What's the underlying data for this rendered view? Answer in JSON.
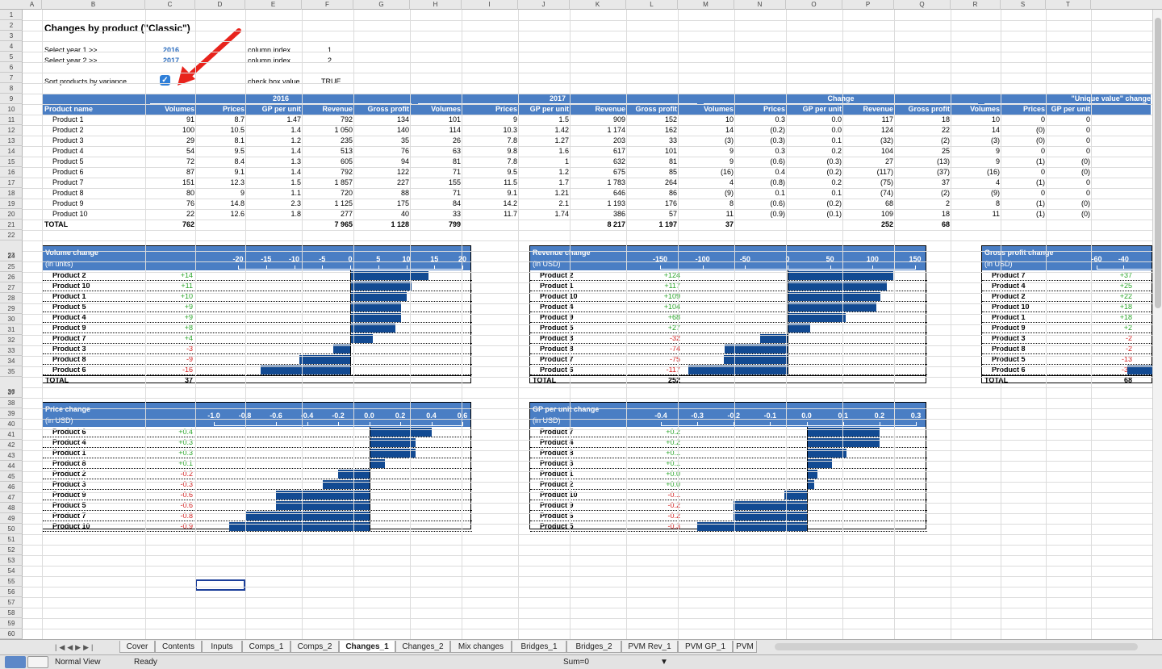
{
  "sheet_title": "Changes by product (\"Classic\")",
  "inputs": {
    "year1_label": "Select year 1 >>",
    "year1_value": "2016",
    "year2_label": "Select year 2 >>",
    "year2_value": "2017",
    "colidx_label": "column index",
    "colidx1": "1",
    "colidx2": "2",
    "sort_label": "Sort products by variance",
    "cbv_label": "check box value",
    "cbv_value": "TRUE"
  },
  "columns": [
    "A",
    "B",
    "C",
    "D",
    "E",
    "F",
    "G",
    "H",
    "I",
    "J",
    "K",
    "L",
    "M",
    "N",
    "O",
    "P",
    "Q",
    "R",
    "S",
    "T"
  ],
  "table": {
    "groups": [
      "2016",
      "2017",
      "Change",
      "\"Unique value\" change"
    ],
    "name_header": "Product name",
    "headers": [
      "Volumes",
      "Prices",
      "GP per unit",
      "Revenue",
      "Gross profit",
      "Volumes",
      "Prices",
      "GP per unit",
      "Revenue",
      "Gross profit",
      "Volumes",
      "Prices",
      "GP per unit",
      "Revenue",
      "Gross profit",
      "Volumes",
      "Prices",
      "GP per unit"
    ],
    "rows": [
      [
        "Product 1",
        "91",
        "8.7",
        "1.47",
        "792",
        "134",
        "101",
        "9",
        "1.5",
        "909",
        "152",
        "10",
        "0.3",
        "0.0",
        "117",
        "18",
        "10",
        "0",
        "0"
      ],
      [
        "Product 2",
        "100",
        "10.5",
        "1.4",
        "1 050",
        "140",
        "114",
        "10.3",
        "1.42",
        "1 174",
        "162",
        "14",
        "(0.2)",
        "0.0",
        "124",
        "22",
        "14",
        "(0)",
        "0"
      ],
      [
        "Product 3",
        "29",
        "8.1",
        "1.2",
        "235",
        "35",
        "26",
        "7.8",
        "1.27",
        "203",
        "33",
        "(3)",
        "(0.3)",
        "0.1",
        "(32)",
        "(2)",
        "(3)",
        "(0)",
        "0"
      ],
      [
        "Product 4",
        "54",
        "9.5",
        "1.4",
        "513",
        "76",
        "63",
        "9.8",
        "1.6",
        "617",
        "101",
        "9",
        "0.3",
        "0.2",
        "104",
        "25",
        "9",
        "0",
        "0"
      ],
      [
        "Product 5",
        "72",
        "8.4",
        "1.3",
        "605",
        "94",
        "81",
        "7.8",
        "1",
        "632",
        "81",
        "9",
        "(0.6)",
        "(0.3)",
        "27",
        "(13)",
        "9",
        "(1)",
        "(0)"
      ],
      [
        "Product 6",
        "87",
        "9.1",
        "1.4",
        "792",
        "122",
        "71",
        "9.5",
        "1.2",
        "675",
        "85",
        "(16)",
        "0.4",
        "(0.2)",
        "(117)",
        "(37)",
        "(16)",
        "0",
        "(0)"
      ],
      [
        "Product 7",
        "151",
        "12.3",
        "1.5",
        "1 857",
        "227",
        "155",
        "11.5",
        "1.7",
        "1 783",
        "264",
        "4",
        "(0.8)",
        "0.2",
        "(75)",
        "37",
        "4",
        "(1)",
        "0"
      ],
      [
        "Product 8",
        "80",
        "9",
        "1.1",
        "720",
        "88",
        "71",
        "9.1",
        "1.21",
        "646",
        "86",
        "(9)",
        "0.1",
        "0.1",
        "(74)",
        "(2)",
        "(9)",
        "0",
        "0"
      ],
      [
        "Product 9",
        "76",
        "14.8",
        "2.3",
        "1 125",
        "175",
        "84",
        "14.2",
        "2.1",
        "1 193",
        "176",
        "8",
        "(0.6)",
        "(0.2)",
        "68",
        "2",
        "8",
        "(1)",
        "(0)"
      ],
      [
        "Product 10",
        "22",
        "12.6",
        "1.8",
        "277",
        "40",
        "33",
        "11.7",
        "1.74",
        "386",
        "57",
        "11",
        "(0.9)",
        "(0.1)",
        "109",
        "18",
        "11",
        "(1)",
        "(0)"
      ]
    ],
    "total": [
      "TOTAL",
      "762",
      "",
      "",
      "7 965",
      "1 128",
      "799",
      "",
      "",
      "8 217",
      "1 197",
      "37",
      "",
      "",
      "252",
      "68",
      "",
      "",
      ""
    ]
  },
  "charts": [
    {
      "id": "volume",
      "title": "Volume change",
      "unit": "(in units)",
      "ticks": [
        "-20",
        "-15",
        "-10",
        "-5",
        "0",
        "5",
        "10",
        "15",
        "20"
      ],
      "min": -20,
      "max": 20,
      "products": [
        "Product 2",
        "Product 10",
        "Product 1",
        "Product 5",
        "Product 4",
        "Product 9",
        "Product 7",
        "Product 3",
        "Product 8",
        "Product 6"
      ],
      "labels": [
        "+14",
        "+11",
        "+10",
        "+9",
        "+9",
        "+8",
        "+4",
        "-3",
        "-9",
        "-16"
      ],
      "values": [
        14,
        11,
        10,
        9,
        9,
        8,
        4,
        -3,
        -9,
        -16
      ],
      "total_label": "TOTAL",
      "total": "37"
    },
    {
      "id": "revenue",
      "title": "Revenue change",
      "unit": "(in USD)",
      "ticks": [
        "-150",
        "-100",
        "-50",
        "0",
        "50",
        "100",
        "150"
      ],
      "min": -150,
      "max": 150,
      "products": [
        "Product 2",
        "Product 1",
        "Product 10",
        "Product 4",
        "Product 9",
        "Product 5",
        "Product 3",
        "Product 8",
        "Product 7",
        "Product 6"
      ],
      "labels": [
        "+124",
        "+117",
        "+109",
        "+104",
        "+68",
        "+27",
        "-32",
        "-74",
        "-75",
        "-117"
      ],
      "values": [
        124,
        117,
        109,
        104,
        68,
        27,
        -32,
        -74,
        -75,
        -117
      ],
      "total_label": "TOTAL",
      "total": "252"
    },
    {
      "id": "gp",
      "title": "Gross profit change",
      "unit": "(in USD)",
      "ticks": [
        "-60",
        "-40"
      ],
      "min": -60,
      "max": 60,
      "products": [
        "Product 7",
        "Product 4",
        "Product 2",
        "Product 10",
        "Product 1",
        "Product 9",
        "Product 3",
        "Product 8",
        "Product 5",
        "Product 6"
      ],
      "labels": [
        "+37",
        "+25",
        "+22",
        "+18",
        "+18",
        "+2",
        "-2",
        "-2",
        "-13",
        "-37"
      ],
      "values": [
        37,
        25,
        22,
        18,
        18,
        2,
        -2,
        -2,
        -13,
        -37
      ],
      "total_label": "TOTAL",
      "total": "68"
    },
    {
      "id": "price",
      "title": "Price change",
      "unit": "(in USD)",
      "ticks": [
        "-1.0",
        "-0.8",
        "-0.6",
        "-0.4",
        "-0.2",
        "0.0",
        "0.2",
        "0.4",
        "0.6"
      ],
      "min": -1.0,
      "max": 0.6,
      "products": [
        "Product 6",
        "Product 4",
        "Product 1",
        "Product 8",
        "Product 2",
        "Product 3",
        "Product 9",
        "Product 5",
        "Product 7",
        "Product 10"
      ],
      "labels": [
        "+0.4",
        "+0.3",
        "+0.3",
        "+0.1",
        "-0.2",
        "-0.3",
        "-0.6",
        "-0.6",
        "-0.8",
        "-0.9"
      ],
      "values": [
        0.4,
        0.3,
        0.3,
        0.1,
        -0.2,
        -0.3,
        -0.6,
        -0.6,
        -0.8,
        -0.9
      ]
    },
    {
      "id": "gpu",
      "title": "GP per unit change",
      "unit": "(in USD)",
      "ticks": [
        "-0.4",
        "-0.3",
        "-0.2",
        "-0.1",
        "0.0",
        "0.1",
        "0.2",
        "0.3"
      ],
      "min": -0.4,
      "max": 0.3,
      "products": [
        "Product 7",
        "Product 4",
        "Product 8",
        "Product 3",
        "Product 1",
        "Product 2",
        "Product 10",
        "Product 9",
        "Product 6",
        "Product 5"
      ],
      "labels": [
        "+0.2",
        "+0.2",
        "+0.1",
        "+0.1",
        "+0.0",
        "+0.0",
        "-0.1",
        "-0.2",
        "-0.2",
        "-0.3"
      ],
      "values": [
        0.2,
        0.2,
        0.11,
        0.07,
        0.03,
        0.02,
        -0.06,
        -0.2,
        -0.2,
        -0.3
      ]
    }
  ],
  "tabs": [
    "Cover",
    "Contents",
    "Inputs",
    "Comps_1",
    "Comps_2",
    "Changes_1",
    "Changes_2",
    "Mix changes",
    "Bridges_1",
    "Bridges_2",
    "PVM Rev_1",
    "PVM GP_1",
    "PVM"
  ],
  "active_tab": "Changes_1",
  "status": {
    "view": "Normal View",
    "state": "Ready",
    "sum": "Sum=0"
  },
  "colors": {
    "header_blue": "#4a7ec4",
    "bar": "#124a92",
    "pos": "#2aa52a",
    "neg": "#d42020"
  }
}
